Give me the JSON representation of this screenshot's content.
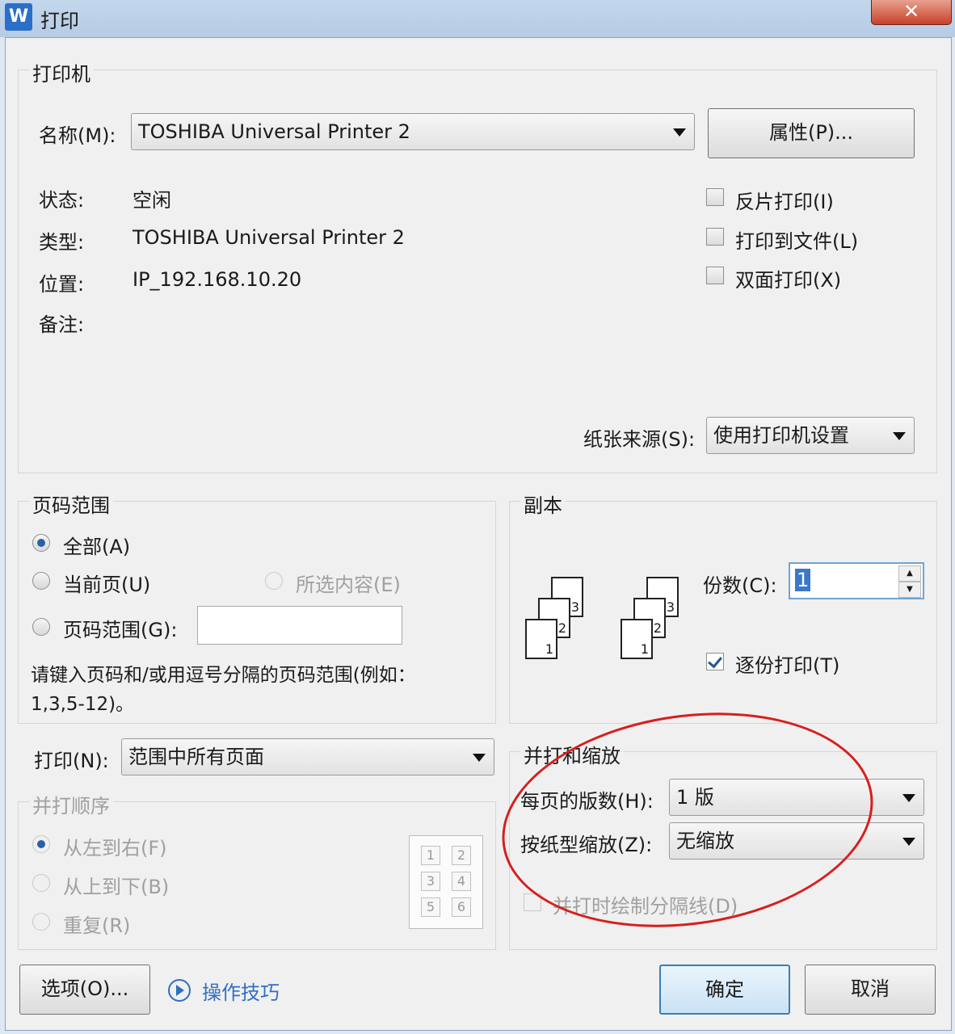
{
  "window": {
    "title": "打印",
    "app_icon_letter": "W",
    "close_glyph": "✕"
  },
  "printer": {
    "legend": "打印机",
    "name_label": "名称(M):",
    "name_value": "TOSHIBA Universal Printer 2",
    "properties_button": "属性(P)...",
    "status_label": "状态:",
    "status_value": "空闲",
    "type_label": "类型:",
    "type_value": "TOSHIBA Universal Printer 2",
    "location_label": "位置:",
    "location_value": "IP_192.168.10.20",
    "comment_label": "备注:",
    "options": {
      "reverse": "反片打印(I)",
      "to_file": "打印到文件(L)",
      "duplex": "双面打印(X)"
    },
    "paper_source_label": "纸张来源(S):",
    "paper_source_value": "使用打印机设置"
  },
  "page_range": {
    "legend": "页码范围",
    "all": "全部(A)",
    "current": "当前页(U)",
    "selection": "所选内容(E)",
    "range": "页码范围(G):",
    "range_value": "",
    "hint": "请键入页码和/或用逗号分隔的页码范围(例如：",
    "hint2": "1,3,5-12)。"
  },
  "copies": {
    "legend": "副本",
    "count_label": "份数(C):",
    "count_value": "1",
    "collate": "逐份打印(T)",
    "page_numbers": [
      "1",
      "2",
      "3"
    ]
  },
  "print_what": {
    "label": "打印(N):",
    "value": "范围中所有页面"
  },
  "order": {
    "legend": "并打顺序",
    "left_right": "从左到右(F)",
    "top_bottom": "从上到下(B)",
    "repeat": "重复(R)",
    "grid": [
      "1",
      "2",
      "3",
      "4",
      "5",
      "6"
    ]
  },
  "zoom": {
    "legend": "并打和缩放",
    "pages_per_sheet_label": "每页的版数(H):",
    "pages_per_sheet_value": "1 版",
    "scale_label": "按纸型缩放(Z):",
    "scale_value": "无缩放",
    "draw_borders": "并打时绘制分隔线(D)"
  },
  "footer": {
    "options": "选项(O)...",
    "tips": "操作技巧",
    "ok": "确定",
    "cancel": "取消"
  },
  "colors": {
    "annotation_oval": "#d71e1e",
    "link": "#2f6fc3"
  }
}
